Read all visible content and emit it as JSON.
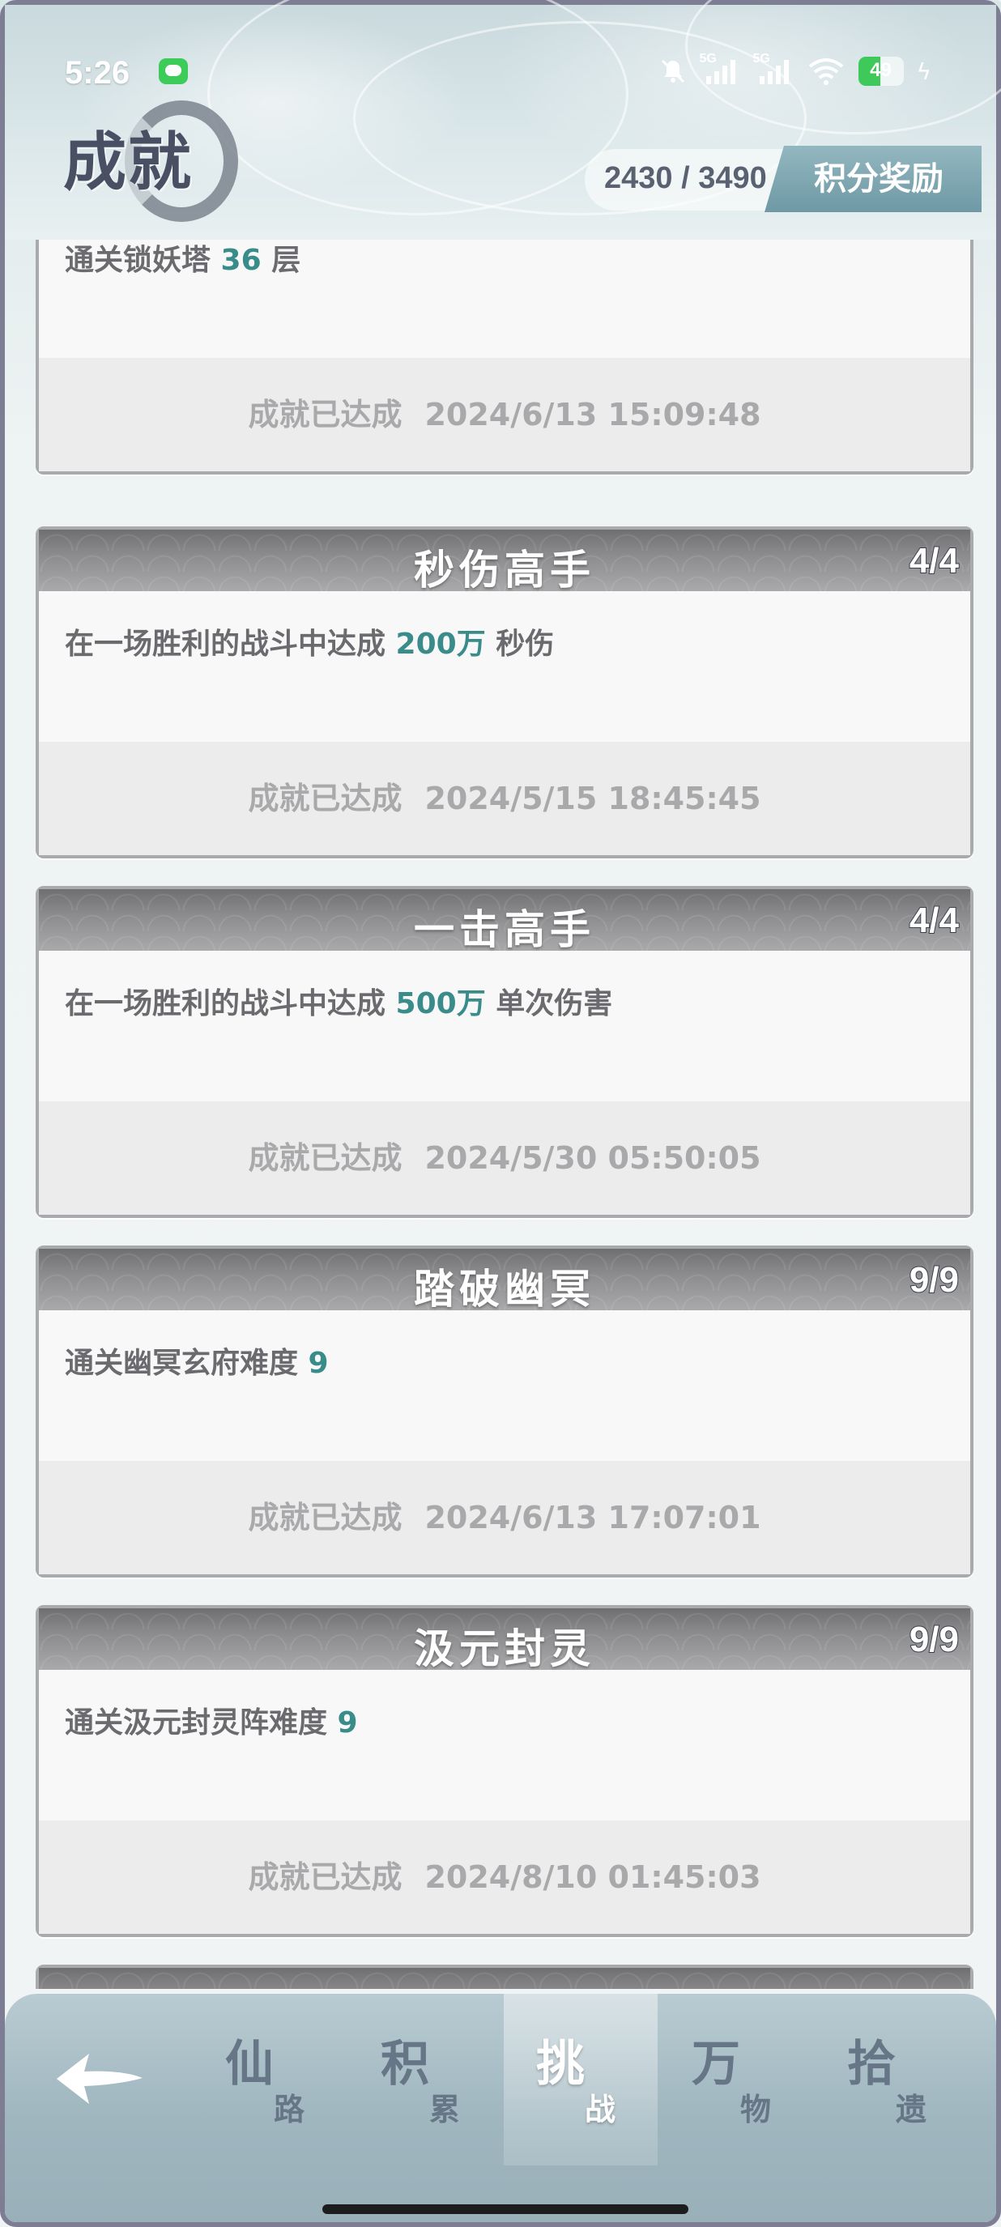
{
  "status_bar": {
    "time": "5:26",
    "network_1": "5G",
    "network_2": "5G",
    "battery": "49"
  },
  "header": {
    "title": "成就",
    "score": "2430 / 3490",
    "reward_button": "积分奖励"
  },
  "cards": [
    {
      "title": "",
      "count": "",
      "desc_prefix": "通关锁妖塔 ",
      "desc_value": "36",
      "desc_suffix": " 层",
      "status_label": "成就已达成",
      "timestamp": "2024/6/13 15:09:48"
    },
    {
      "title": "秒伤高手",
      "count": "4/4",
      "desc_prefix": "在一场胜利的战斗中达成 ",
      "desc_value": "200万",
      "desc_suffix": " 秒伤",
      "status_label": "成就已达成",
      "timestamp": "2024/5/15 18:45:45"
    },
    {
      "title": "一击高手",
      "count": "4/4",
      "desc_prefix": "在一场胜利的战斗中达成 ",
      "desc_value": "500万",
      "desc_suffix": " 单次伤害",
      "status_label": "成就已达成",
      "timestamp": "2024/5/30 05:50:05"
    },
    {
      "title": "踏破幽冥",
      "count": "9/9",
      "desc_prefix": "通关幽冥玄府难度 ",
      "desc_value": "9",
      "desc_suffix": "",
      "status_label": "成就已达成",
      "timestamp": "2024/6/13 17:07:01"
    },
    {
      "title": "汲元封灵",
      "count": "9/9",
      "desc_prefix": "通关汲元封灵阵难度 ",
      "desc_value": "9",
      "desc_suffix": "",
      "status_label": "成就已达成",
      "timestamp": "2024/8/10 01:45:03"
    }
  ],
  "bottom_nav": {
    "tabs": [
      {
        "big": "仙",
        "small": "路"
      },
      {
        "big": "积",
        "small": "累"
      },
      {
        "big": "挑",
        "small": "战"
      },
      {
        "big": "万",
        "small": "物"
      },
      {
        "big": "拾",
        "small": "遗"
      }
    ],
    "active_index": 2
  },
  "colors": {
    "highlight": "#3a8c8a",
    "card_header": "#8b8b8d",
    "nav_bg": "#a6bcc4"
  },
  "icons": [
    "message-icon",
    "bell-muted-icon",
    "signal-icon",
    "wifi-icon",
    "battery-icon",
    "charging-icon",
    "back-arrow-icon"
  ]
}
